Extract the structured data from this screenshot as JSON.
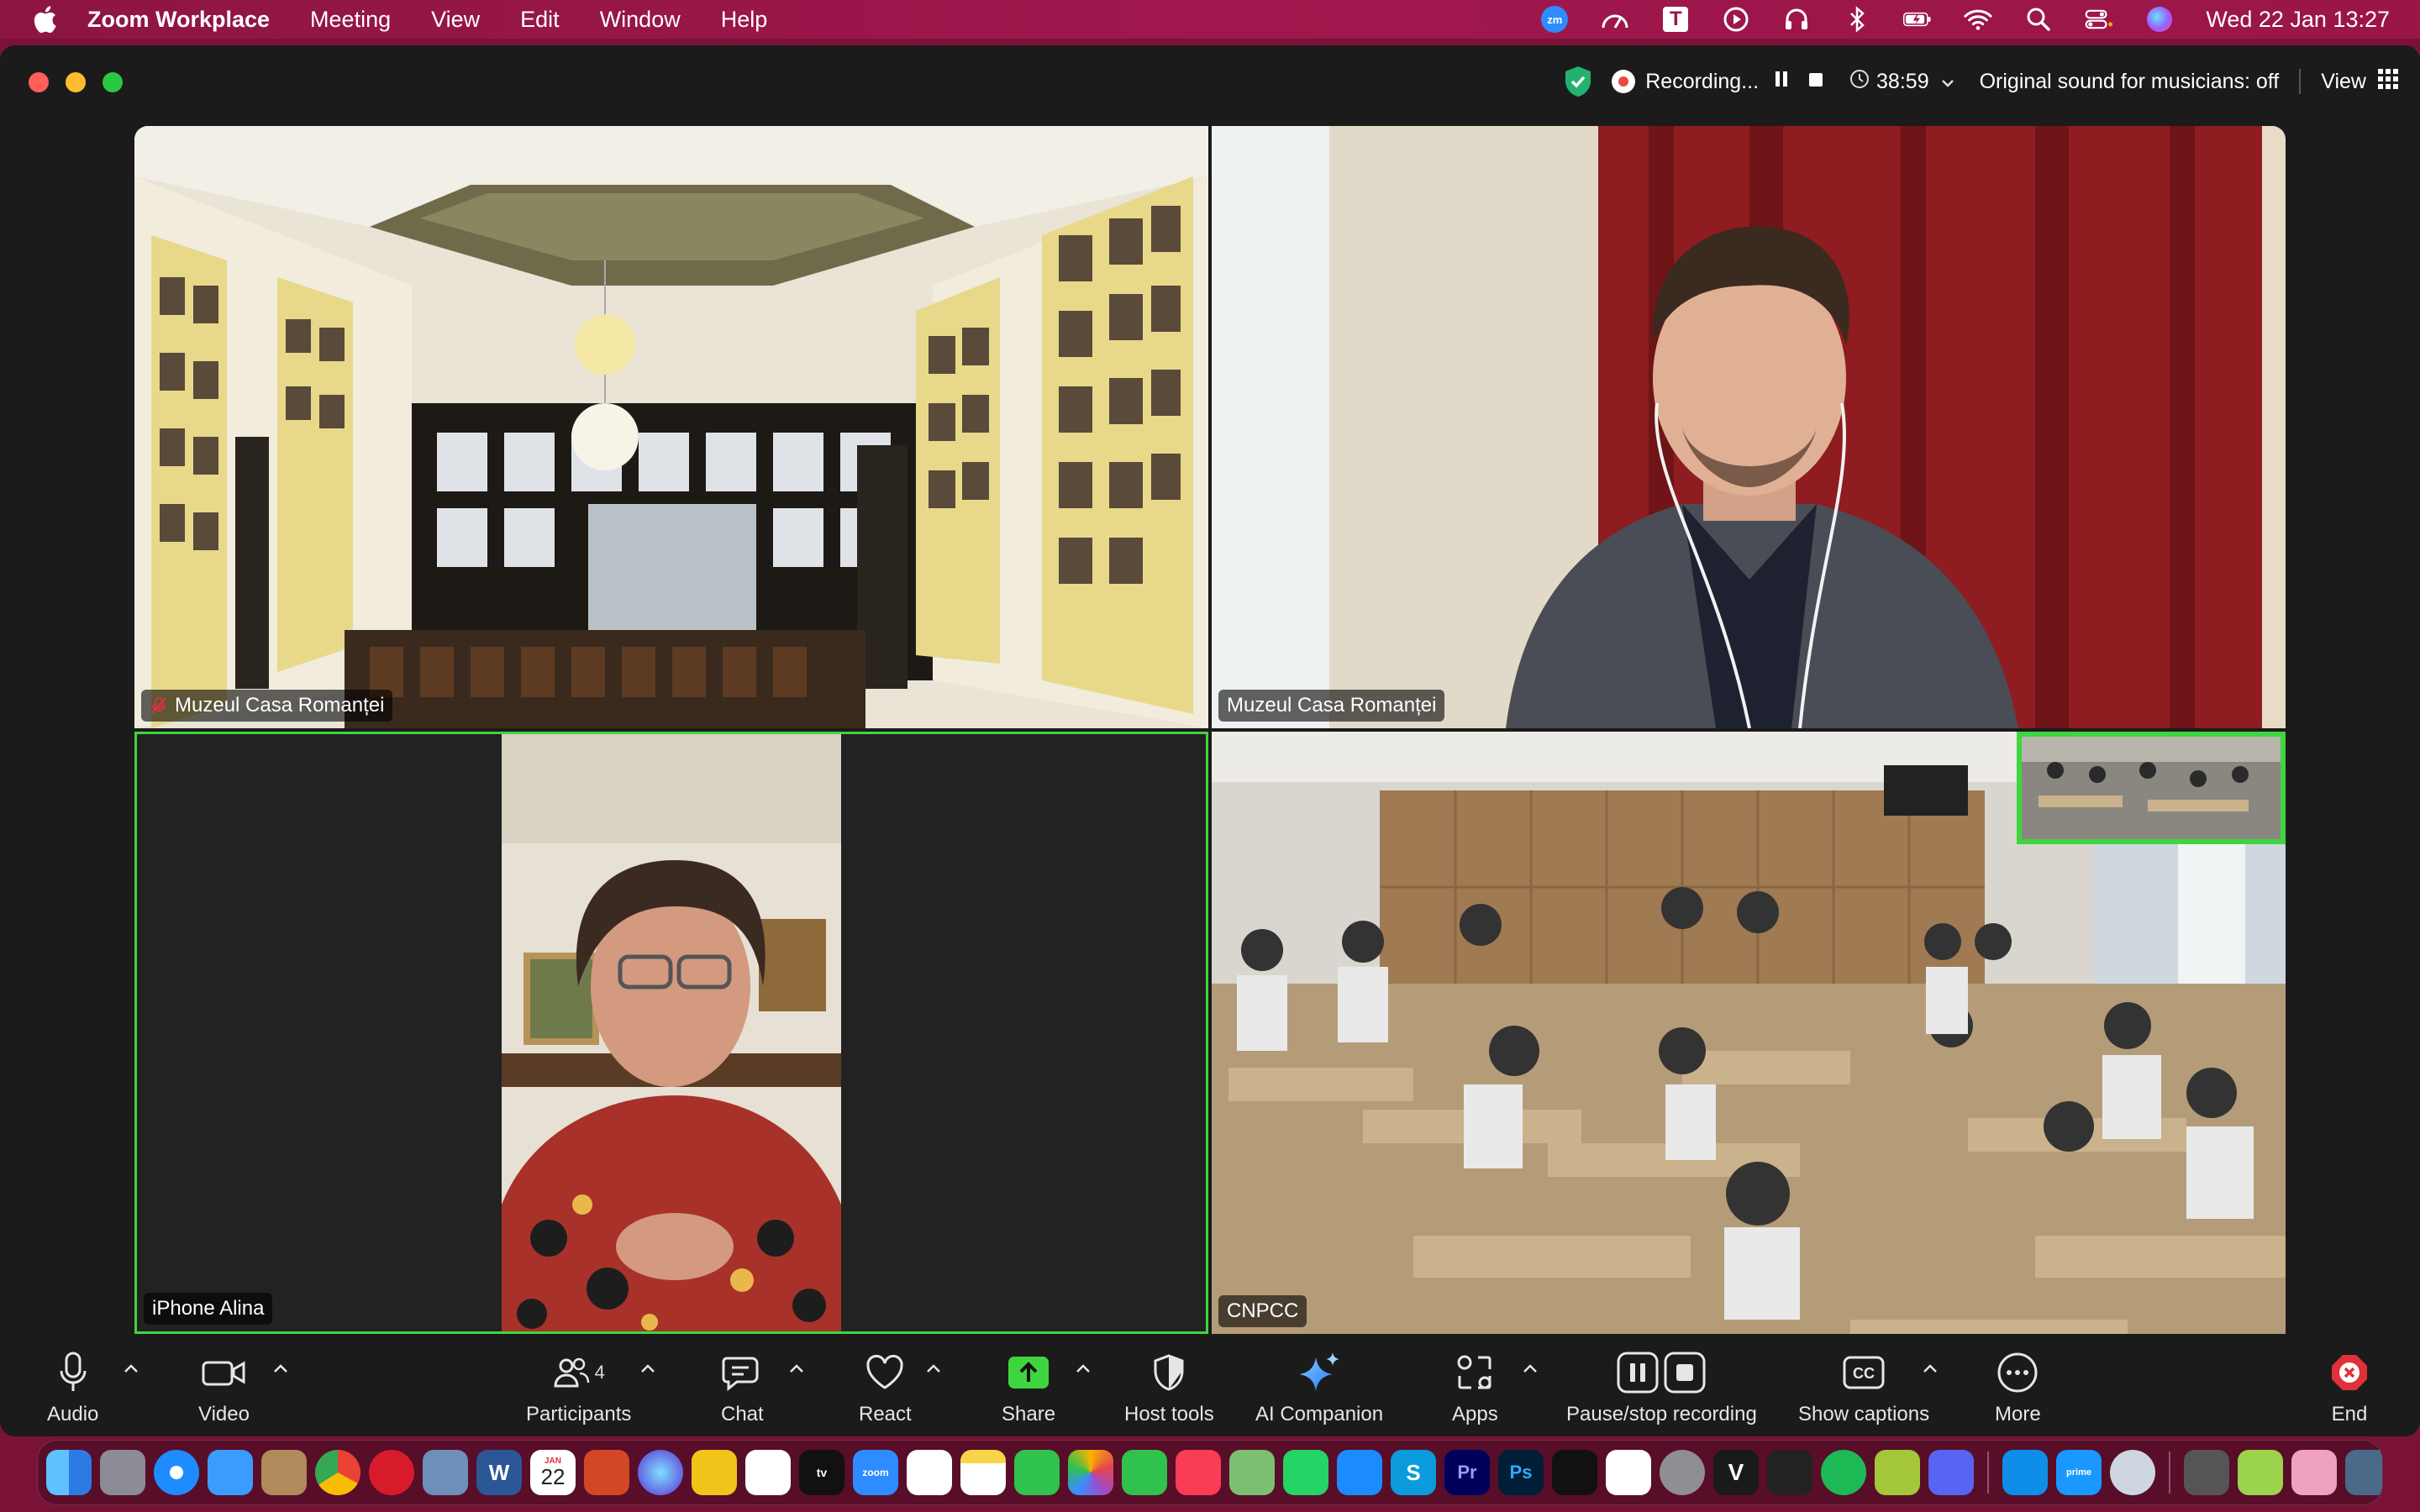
{
  "menubar": {
    "app_name": "Zoom Workplace",
    "items": [
      "Meeting",
      "View",
      "Edit",
      "Window",
      "Help"
    ],
    "clock": "Wed 22 Jan  13:27",
    "zoom_badge": "zm"
  },
  "topbar": {
    "recording_label": "Recording...",
    "timer": "38:59",
    "original_sound": "Original sound for musicians: off",
    "view_label": "View"
  },
  "tiles": [
    {
      "name": "Muzeul Casa Romanței",
      "muted": true
    },
    {
      "name": "Muzeul Casa Romanței",
      "muted": false
    },
    {
      "name": "iPhone Alina",
      "muted": false,
      "active_speaker": true
    },
    {
      "name": "CNPCC",
      "muted": false
    }
  ],
  "toolbar": {
    "audio": "Audio",
    "video": "Video",
    "participants": "Participants",
    "participants_count": "4",
    "chat": "Chat",
    "react": "React",
    "share": "Share",
    "host_tools": "Host tools",
    "ai_companion": "AI Companion",
    "apps": "Apps",
    "pause_stop_recording": "Pause/stop recording",
    "show_captions": "Show captions",
    "more": "More",
    "end": "End"
  },
  "colors": {
    "active_speaker": "#3fd53f",
    "share_green": "#3fd53f",
    "end_red": "#e0303a",
    "menubar": "#9a1648"
  },
  "dock": {
    "calendar_month": "JAN",
    "calendar_day": "22",
    "word_letter": "W",
    "ps_letters": "Ps",
    "pr_letters": "Pr",
    "apple_tv": "tv",
    "zoom": "zoom",
    "skype": "S",
    "vim": "V",
    "prime": "prime",
    "icons": [
      "finder",
      "launchpad",
      "safari",
      "mail",
      "contacts",
      "chrome",
      "opera",
      "preview",
      "word",
      "calendar",
      "powerpoint",
      "siri",
      "radioactive",
      "freeform",
      "apple-tv",
      "zoom",
      "reminders",
      "notes",
      "facetime",
      "photos",
      "messages",
      "music",
      "maps",
      "whatsapp",
      "app-store",
      "skype",
      "premiere",
      "photoshop",
      "tiktok",
      "capcut",
      "system-settings",
      "vim",
      "audio",
      "spotify",
      "android-file",
      "discord",
      "teamviewer",
      "prime-video",
      "quicktime",
      "screenshot",
      "archive",
      "photos-2",
      "downloads",
      "trash"
    ]
  }
}
